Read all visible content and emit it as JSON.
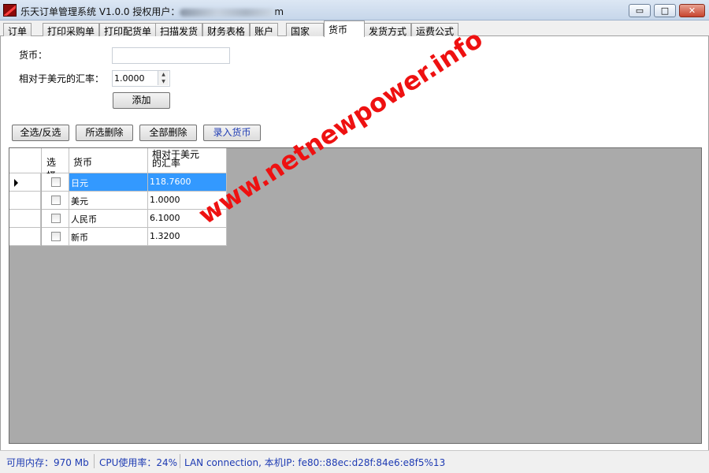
{
  "window": {
    "title": "乐天订单管理系统 V1.0.0 授权用户：",
    "title_tail": "m",
    "controls": {
      "minimize": "▭",
      "maximize": "□",
      "close": "✕"
    }
  },
  "tabs": [
    {
      "label": "订单"
    },
    {
      "label": "打印采购单"
    },
    {
      "label": "打印配货单"
    },
    {
      "label": "扫描发货"
    },
    {
      "label": "财务表格"
    },
    {
      "label": "账户"
    },
    {
      "label": "国家"
    },
    {
      "label": "货币",
      "active": true
    },
    {
      "label": "发货方式"
    },
    {
      "label": "运费公式"
    }
  ],
  "form": {
    "currency_label": "货币：",
    "currency_value": "",
    "rate_label": "相对于美元的汇率：",
    "rate_value": "1.0000",
    "add_button": "添加"
  },
  "toolbar": {
    "select_all": "全选/反选",
    "delete_selected": "所选删除",
    "delete_all": "全部删除",
    "enter_currency": "录入货币"
  },
  "grid": {
    "headers": {
      "select": "选择",
      "currency": "货币",
      "rate_line1": "相对于美元",
      "rate_line2": "的汇率"
    },
    "rows": [
      {
        "currency": "日元",
        "rate": "118.7600",
        "checked": false,
        "selected": true
      },
      {
        "currency": "美元",
        "rate": "1.0000",
        "checked": false,
        "selected": false
      },
      {
        "currency": "人民币",
        "rate": "6.1000",
        "checked": false,
        "selected": false
      },
      {
        "currency": "新币",
        "rate": "1.3200",
        "checked": false,
        "selected": false
      }
    ]
  },
  "watermark": "www.netnewpower.info",
  "status": {
    "memory": "可用内存：970 Mb",
    "cpu": "CPU使用率：24%",
    "lan": "LAN connection,  本机IP: fe80::88ec:d28f:84e6:e8f5%13"
  }
}
